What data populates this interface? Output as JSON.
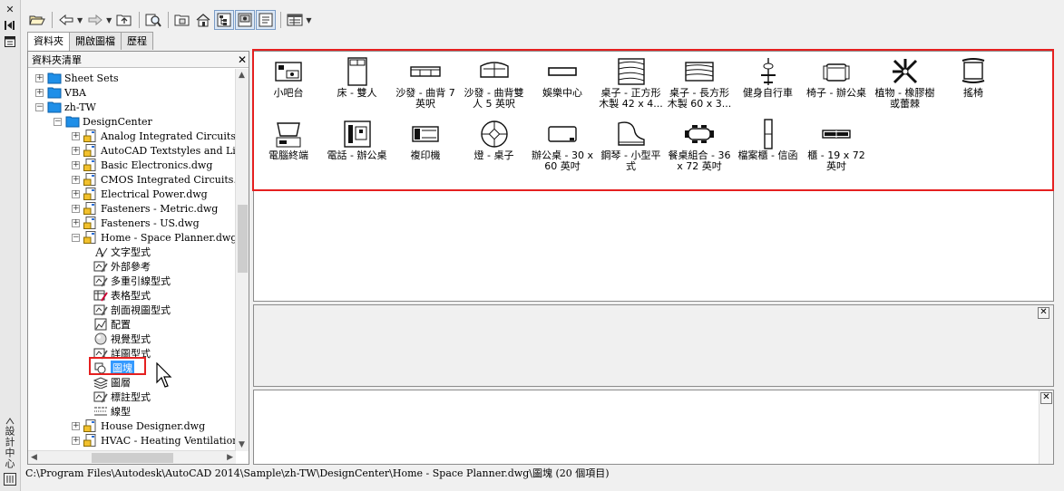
{
  "side_strip": {
    "close_glyph": "✕",
    "palette_title": "設計中心"
  },
  "toolbar": {
    "icons": [
      "load-icon",
      "back-icon",
      "forward-icon",
      "up-icon",
      "search-icon",
      "favorites-icon",
      "home-icon",
      "tree-view-toggle-icon",
      "preview-icon",
      "description-icon",
      "views-icon"
    ]
  },
  "tabs": [
    {
      "label": "資料夾",
      "active": true
    },
    {
      "label": "開啟圖檔",
      "active": false
    },
    {
      "label": "歷程",
      "active": false
    }
  ],
  "tree": {
    "header": "資料夾清單",
    "rows": [
      {
        "label": "Sheet Sets",
        "indent": 0,
        "expander": "+",
        "icon": "folder-icon",
        "selected": false
      },
      {
        "label": "VBA",
        "indent": 0,
        "expander": "+",
        "icon": "folder-icon",
        "selected": false
      },
      {
        "label": "zh-TW",
        "indent": 0,
        "expander": "−",
        "icon": "folder-icon",
        "selected": false
      },
      {
        "label": "DesignCenter",
        "indent": 1,
        "expander": "−",
        "icon": "folder-icon",
        "selected": false
      },
      {
        "label": "Analog Integrated Circuits.dwg",
        "indent": 2,
        "expander": "+",
        "icon": "drawing-icon",
        "selected": false
      },
      {
        "label": "AutoCAD Textstyles and Linety",
        "indent": 2,
        "expander": "+",
        "icon": "drawing-icon",
        "selected": false
      },
      {
        "label": "Basic Electronics.dwg",
        "indent": 2,
        "expander": "+",
        "icon": "drawing-icon",
        "selected": false
      },
      {
        "label": "CMOS Integrated Circuits.dwg",
        "indent": 2,
        "expander": "+",
        "icon": "drawing-icon",
        "selected": false
      },
      {
        "label": "Electrical Power.dwg",
        "indent": 2,
        "expander": "+",
        "icon": "drawing-icon",
        "selected": false
      },
      {
        "label": "Fasteners - Metric.dwg",
        "indent": 2,
        "expander": "+",
        "icon": "drawing-icon",
        "selected": false
      },
      {
        "label": "Fasteners - US.dwg",
        "indent": 2,
        "expander": "+",
        "icon": "drawing-icon",
        "selected": false
      },
      {
        "label": "Home - Space Planner.dwg",
        "indent": 2,
        "expander": "−",
        "icon": "drawing-icon",
        "selected": false
      },
      {
        "label": "文字型式",
        "indent": 3,
        "expander": "",
        "icon": "text-style-icon",
        "selected": false
      },
      {
        "label": "外部參考",
        "indent": 3,
        "expander": "",
        "icon": "xref-icon",
        "selected": false
      },
      {
        "label": "多重引線型式",
        "indent": 3,
        "expander": "",
        "icon": "multileader-style-icon",
        "selected": false
      },
      {
        "label": "表格型式",
        "indent": 3,
        "expander": "",
        "icon": "table-style-icon",
        "selected": false
      },
      {
        "label": "剖面視圖型式",
        "indent": 3,
        "expander": "",
        "icon": "section-view-style-icon",
        "selected": false
      },
      {
        "label": "配置",
        "indent": 3,
        "expander": "",
        "icon": "layout-icon",
        "selected": false
      },
      {
        "label": "視覺型式",
        "indent": 3,
        "expander": "",
        "icon": "visual-style-icon",
        "selected": false
      },
      {
        "label": "詳圖型式",
        "indent": 3,
        "expander": "",
        "icon": "detail-view-style-icon",
        "selected": false
      },
      {
        "label": "圖塊",
        "indent": 3,
        "expander": "",
        "icon": "block-icon",
        "selected": true
      },
      {
        "label": "圖層",
        "indent": 3,
        "expander": "",
        "icon": "layer-icon",
        "selected": false
      },
      {
        "label": "標註型式",
        "indent": 3,
        "expander": "",
        "icon": "dimension-style-icon",
        "selected": false
      },
      {
        "label": "線型",
        "indent": 3,
        "expander": "",
        "icon": "linetype-icon",
        "selected": false
      },
      {
        "label": "House Designer.dwg",
        "indent": 2,
        "expander": "+",
        "icon": "drawing-icon",
        "selected": false
      },
      {
        "label": "HVAC - Heating Ventilation Ai",
        "indent": 2,
        "expander": "+",
        "icon": "drawing-icon",
        "selected": false
      }
    ]
  },
  "blocks": [
    {
      "label": "小吧台",
      "icon": "wet-bar-icon"
    },
    {
      "label": "床 - 雙人",
      "icon": "double-bed-icon"
    },
    {
      "label": "沙發 - 曲背 7 英呎",
      "icon": "sofa-7ft-icon"
    },
    {
      "label": "沙發 - 曲背雙人 5 英呎",
      "icon": "loveseat-5ft-icon"
    },
    {
      "label": "娛樂中心",
      "icon": "entertainment-center-icon"
    },
    {
      "label": "桌子 - 正方形木製 42 x 4...",
      "icon": "square-table-icon"
    },
    {
      "label": "桌子 - 長方形木製 60 x 3...",
      "icon": "rectangular-table-icon"
    },
    {
      "label": "健身自行車",
      "icon": "exercise-bike-icon"
    },
    {
      "label": "椅子 - 辦公桌",
      "icon": "desk-chair-icon"
    },
    {
      "label": "植物 - 橡膠樹或蕾棘",
      "icon": "plant-icon"
    },
    {
      "label": "搖椅",
      "icon": "rocking-chair-icon"
    },
    {
      "label": "電腦終端",
      "icon": "computer-terminal-icon"
    },
    {
      "label": "電話 - 辦公桌",
      "icon": "desk-phone-icon"
    },
    {
      "label": "複印機",
      "icon": "copier-icon"
    },
    {
      "label": "燈 - 桌子",
      "icon": "table-lamp-icon"
    },
    {
      "label": "辦公桌 - 30 x 60 英吋",
      "icon": "office-desk-icon"
    },
    {
      "label": "鋼琴 - 小型平式",
      "icon": "grand-piano-icon"
    },
    {
      "label": "餐桌組合 - 36 x 72 英吋",
      "icon": "dining-set-icon"
    },
    {
      "label": "檔案櫃 - 信函",
      "icon": "file-cabinet-icon"
    },
    {
      "label": "櫃 - 19 x 72 英吋",
      "icon": "cabinet-icon"
    }
  ],
  "status": "C:\\Program Files\\Autodesk\\AutoCAD 2014\\Sample\\zh-TW\\DesignCenter\\Home - Space Planner.dwg\\圖塊 (20 個項目)",
  "colors": {
    "highlight": "#e52020",
    "selection": "#3399ff"
  }
}
